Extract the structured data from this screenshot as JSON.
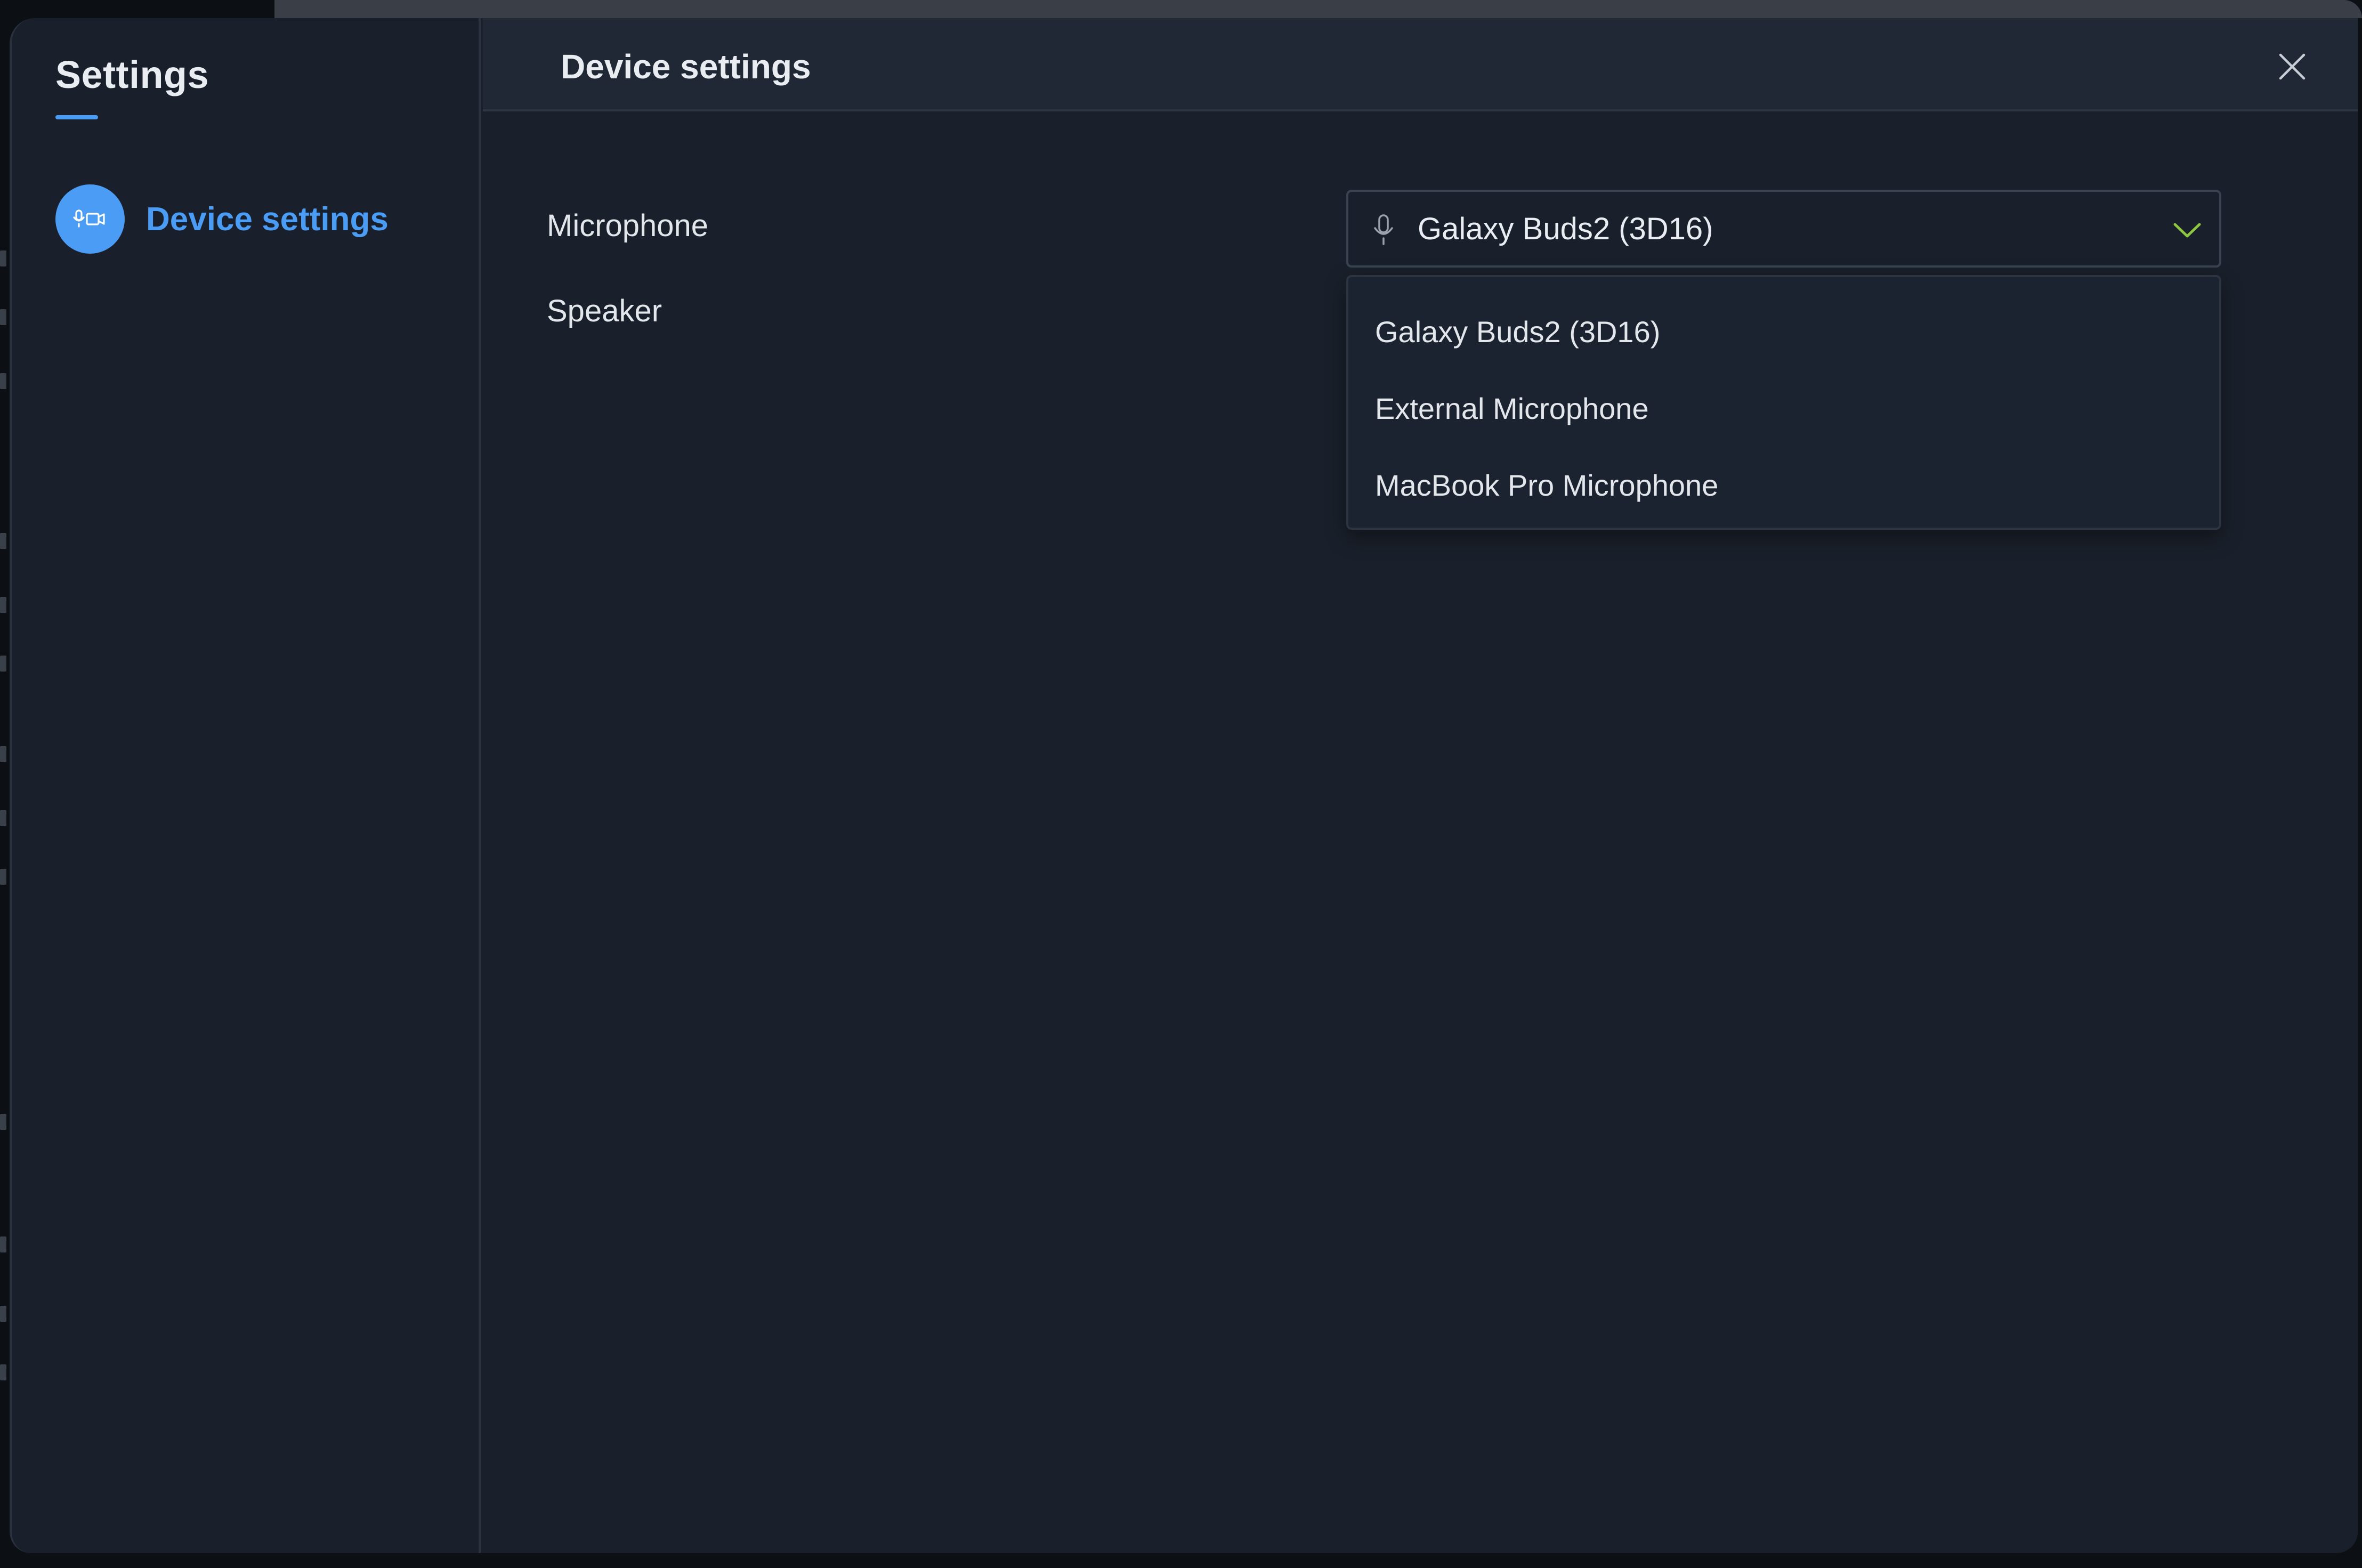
{
  "sidebar": {
    "title": "Settings",
    "items": [
      {
        "label": "Device settings",
        "icon": "video-mic-icon",
        "active": true
      }
    ]
  },
  "main": {
    "title": "Device settings",
    "rows": {
      "microphone_label": "Microphone",
      "speaker_label": "Speaker"
    },
    "microphone_select": {
      "selected": "Galaxy Buds2 (3D16)",
      "expanded": true,
      "options": [
        "Galaxy Buds2 (3D16)",
        "External Microphone",
        "MacBook Pro Microphone"
      ]
    }
  },
  "colors": {
    "accent": "#4a9cf5",
    "chevron": "#8dc63f",
    "background": "#1a202b",
    "header": "#1f2834",
    "text": "#e9edf2"
  }
}
